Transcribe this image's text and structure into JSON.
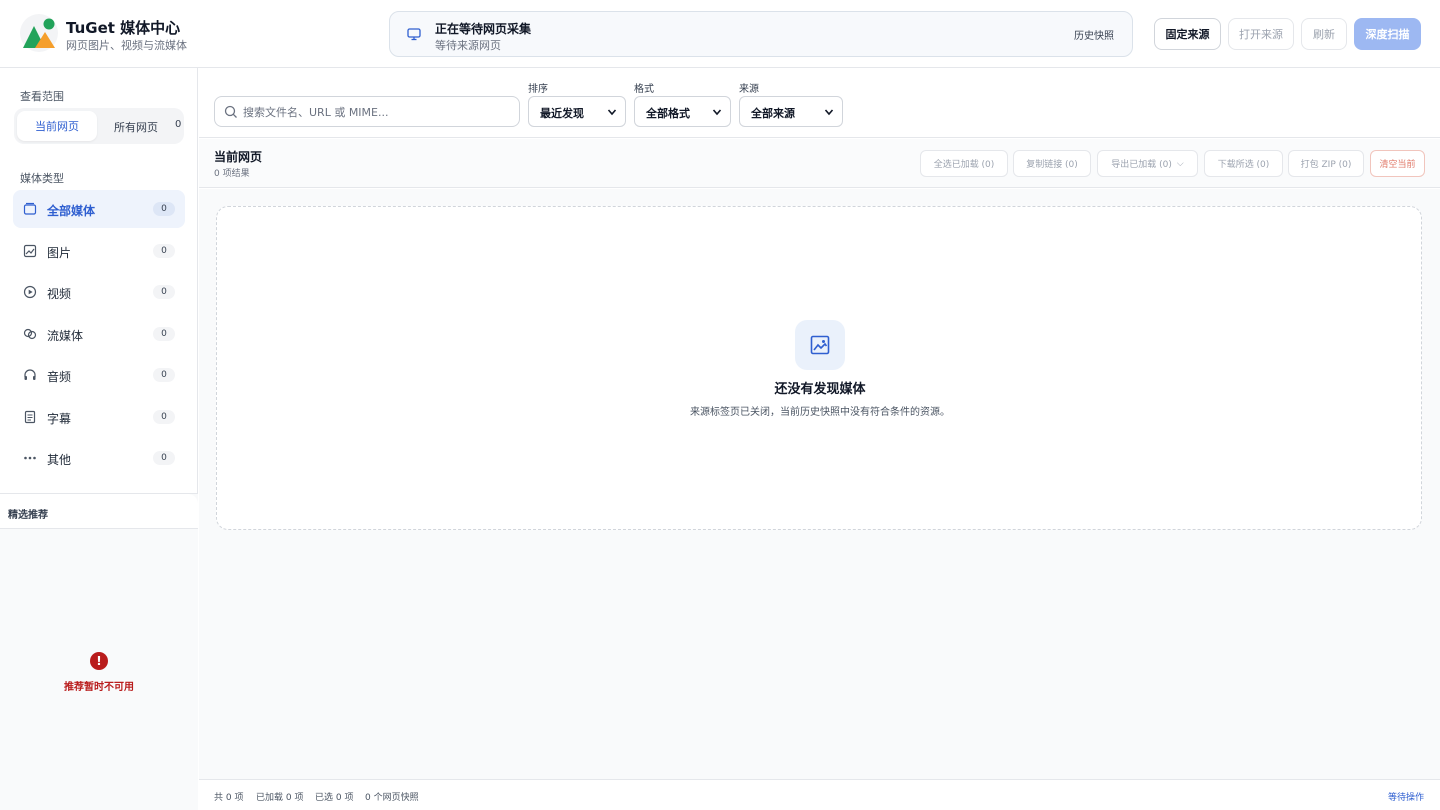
{
  "header": {
    "app_title": "TuGet 媒体中心",
    "app_subtitle": "网页图片、视频与流媒体",
    "status_title": "正在等待网页采集",
    "status_subtitle": "等待来源网页",
    "history_label": "历史快照",
    "buttons": {
      "fix_source": "固定来源",
      "open_source": "打开来源",
      "refresh": "刷新",
      "deep_scan": "深度扫描"
    }
  },
  "sidebar": {
    "scope_label": "查看范围",
    "scope_current": "当前网页",
    "scope_all": "所有网页",
    "scope_all_count": "0",
    "media_type_label": "媒体类型",
    "media_types": [
      {
        "label": "全部媒体",
        "count": "0",
        "icon": "all-media-icon"
      },
      {
        "label": "图片",
        "count": "0",
        "icon": "image-icon"
      },
      {
        "label": "视频",
        "count": "0",
        "icon": "play-circle-icon"
      },
      {
        "label": "流媒体",
        "count": "0",
        "icon": "stream-icon"
      },
      {
        "label": "音频",
        "count": "0",
        "icon": "headphones-icon"
      },
      {
        "label": "字幕",
        "count": "0",
        "icon": "subtitle-doc-icon"
      },
      {
        "label": "其他",
        "count": "0",
        "icon": "more-dots-icon"
      }
    ],
    "featured_title": "精选推荐",
    "featured_error": "推荐暂时不可用"
  },
  "filters": {
    "search_placeholder": "搜索文件名、URL 或 MIME...",
    "sort_label": "排序",
    "sort_value": "最近发现",
    "format_label": "格式",
    "format_value": "全部格式",
    "source_label": "来源",
    "source_value": "全部来源"
  },
  "toolbar": {
    "title": "当前网页",
    "subtitle": "0 项结果",
    "select_loaded": "全选已加载 (0)",
    "copy_links": "复制链接 (0)",
    "export_loaded": "导出已加载 (0)",
    "download_selected": "下载所选 (0)",
    "pack_zip": "打包 ZIP (0)",
    "clear_current": "清空当前"
  },
  "empty_state": {
    "title": "还没有发现媒体",
    "description": "来源标签页已关闭，当前历史快照中没有符合条件的资源。"
  },
  "footer": {
    "total": "共 0 项",
    "loaded": "已加载 0 项",
    "selected": "已选 0 项",
    "snapshots": "0 个网页快照",
    "status": "等待操作"
  },
  "colors": {
    "accent": "#2f5fd0",
    "accent_light": "#9db8f2",
    "danger": "#b91c1c"
  }
}
